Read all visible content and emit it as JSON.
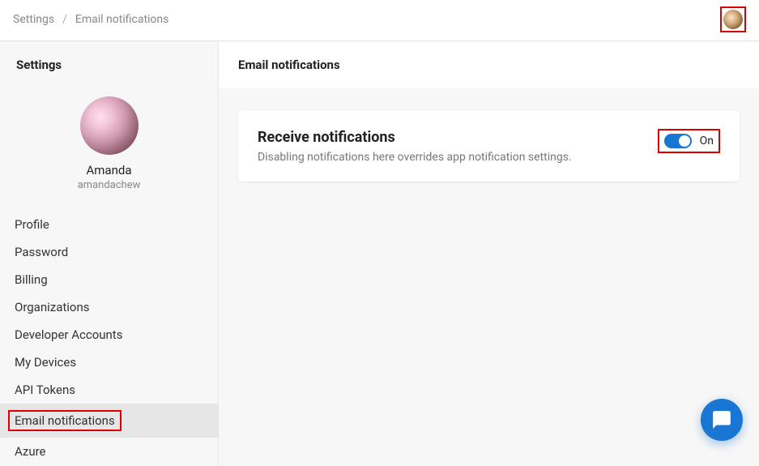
{
  "breadcrumb": {
    "parent": "Settings",
    "separator": "/",
    "current": "Email notifications"
  },
  "sidebar": {
    "title": "Settings",
    "profile": {
      "name": "Amanda",
      "username": "amandachew"
    },
    "items": [
      {
        "label": "Profile",
        "active": false
      },
      {
        "label": "Password",
        "active": false
      },
      {
        "label": "Billing",
        "active": false
      },
      {
        "label": "Organizations",
        "active": false
      },
      {
        "label": "Developer Accounts",
        "active": false
      },
      {
        "label": "My Devices",
        "active": false
      },
      {
        "label": "API Tokens",
        "active": false
      },
      {
        "label": "Email notifications",
        "active": true
      },
      {
        "label": "Azure",
        "active": false
      }
    ]
  },
  "content": {
    "header": "Email notifications",
    "card": {
      "title": "Receive notifications",
      "description": "Disabling notifications here overrides app notification settings.",
      "toggle": {
        "on": true,
        "label": "On"
      }
    }
  },
  "colors": {
    "accent": "#1976d2",
    "highlight_border": "#d00"
  }
}
